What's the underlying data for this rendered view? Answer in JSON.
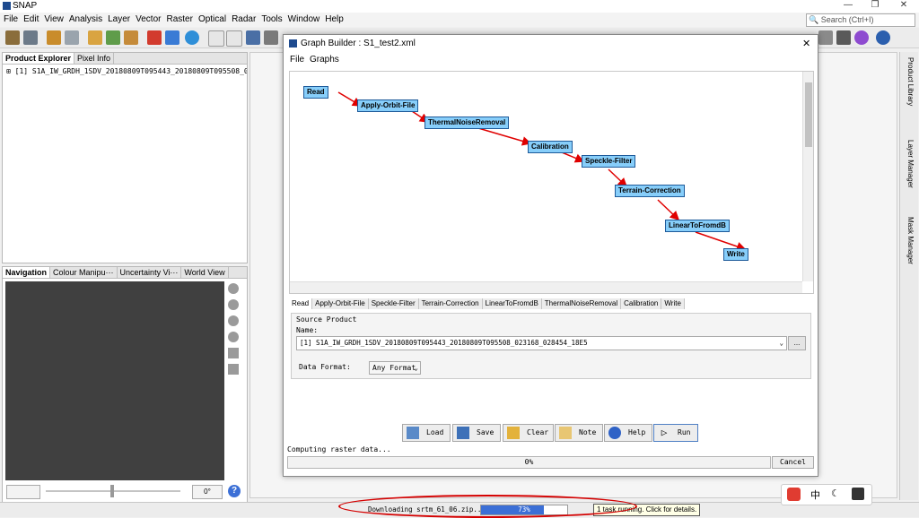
{
  "app": {
    "title": "SNAP",
    "search_placeholder": "Search (Ctrl+I)"
  },
  "menu": [
    "File",
    "Edit",
    "View",
    "Analysis",
    "Layer",
    "Vector",
    "Raster",
    "Optical",
    "Radar",
    "Tools",
    "Window",
    "Help"
  ],
  "product_explorer": {
    "tabs": [
      "Product Explorer",
      "Pixel Info"
    ],
    "item": "[1] S1A_IW_GRDH_1SDV_20180809T095443_20180809T095508_023168_0"
  },
  "navigation": {
    "tabs": [
      "Navigation",
      "Colour Manipu···",
      "Uncertainty Vi···",
      "World View"
    ],
    "angle_value": "0°"
  },
  "side_tabs": [
    "Product Library",
    "Layer Manager",
    "Mask Manager"
  ],
  "dialog": {
    "title": "Graph Builder : S1_test2.xml",
    "menu": [
      "File",
      "Graphs"
    ],
    "nodes": [
      {
        "label": "Read"
      },
      {
        "label": "Apply-Orbit-File"
      },
      {
        "label": "ThermalNoiseRemoval"
      },
      {
        "label": "Calibration"
      },
      {
        "label": "Speckle-Filter"
      },
      {
        "label": "Terrain-Correction"
      },
      {
        "label": "LinearToFromdB"
      },
      {
        "label": "Write"
      }
    ],
    "op_tabs": [
      "Read",
      "Apply-Orbit-File",
      "Speckle-Filter",
      "Terrain-Correction",
      "LinearToFromdB",
      "ThermalNoiseRemoval",
      "Calibration",
      "Write"
    ],
    "source_product": {
      "group_label": "Source Product",
      "name_label": "Name:",
      "name_value": "[1] S1A_IW_GRDH_1SDV_20180809T095443_20180809T095508_023168_028454_18E5",
      "browse_label": "...",
      "format_label": "Data Format:",
      "format_value": "Any Format"
    },
    "buttons": {
      "load": "Load",
      "save": "Save",
      "clear": "Clear",
      "note": "Note",
      "help": "Help",
      "run": "Run"
    },
    "status_text": "Computing raster data...",
    "progress_text": "0%",
    "progress": 0,
    "cancel_label": "Cancel"
  },
  "statusbar": {
    "download_text": "Downloading srtm_61_06.zip...",
    "download_progress_text": "73%",
    "download_progress": 73,
    "tasks_text": "1 task running. Click for details."
  },
  "colors": {
    "node_fill": "#87cefa",
    "node_border": "#1e5a99",
    "edge": "#e00000",
    "annotation": "#d40000",
    "progress": "#3b6fd6"
  }
}
